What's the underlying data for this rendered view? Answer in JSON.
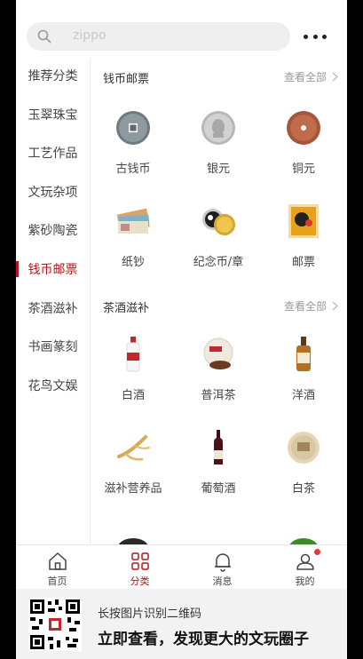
{
  "search": {
    "placeholder": "zippo",
    "icon": "search-icon"
  },
  "sidebar": {
    "items": [
      {
        "label": "推荐分类"
      },
      {
        "label": "玉翠珠宝"
      },
      {
        "label": "工艺作品"
      },
      {
        "label": "文玩杂项"
      },
      {
        "label": "紫砂陶瓷"
      },
      {
        "label": "钱币邮票",
        "active": true
      },
      {
        "label": "茶酒滋补"
      },
      {
        "label": "书画篆刻"
      },
      {
        "label": "花鸟文娱"
      }
    ]
  },
  "sections": [
    {
      "title": "钱币邮票",
      "view_all": "查看全部",
      "items": [
        {
          "label": "古钱币",
          "icon": "ancient-coin-icon"
        },
        {
          "label": "银元",
          "icon": "silver-dollar-icon"
        },
        {
          "label": "铜元",
          "icon": "copper-coin-icon"
        },
        {
          "label": "纸钞",
          "icon": "banknote-icon"
        },
        {
          "label": "纪念币/章",
          "icon": "commemorative-coin-icon"
        },
        {
          "label": "邮票",
          "icon": "stamp-icon"
        }
      ]
    },
    {
      "title": "茶酒滋补",
      "view_all": "查看全部",
      "items": [
        {
          "label": "白酒",
          "icon": "baijiu-icon"
        },
        {
          "label": "普洱茶",
          "icon": "puer-tea-icon"
        },
        {
          "label": "洋酒",
          "icon": "whisky-icon"
        },
        {
          "label": "滋补营养品",
          "icon": "ginseng-icon"
        },
        {
          "label": "葡萄酒",
          "icon": "wine-bottle-icon"
        },
        {
          "label": "白茶",
          "icon": "white-tea-icon"
        }
      ]
    }
  ],
  "tabbar": {
    "items": [
      {
        "label": "首页",
        "icon": "home-icon"
      },
      {
        "label": "分类",
        "icon": "category-grid-icon",
        "active": true
      },
      {
        "label": "消息",
        "icon": "bell-icon"
      },
      {
        "label": "我的",
        "icon": "user-icon",
        "badge": true
      }
    ]
  },
  "banner": {
    "small": "长按图片识别二维码",
    "big": "立即查看，发现更大的文玩圈子"
  },
  "colors": {
    "accent": "#b4161b",
    "badge": "#e23b3b"
  }
}
